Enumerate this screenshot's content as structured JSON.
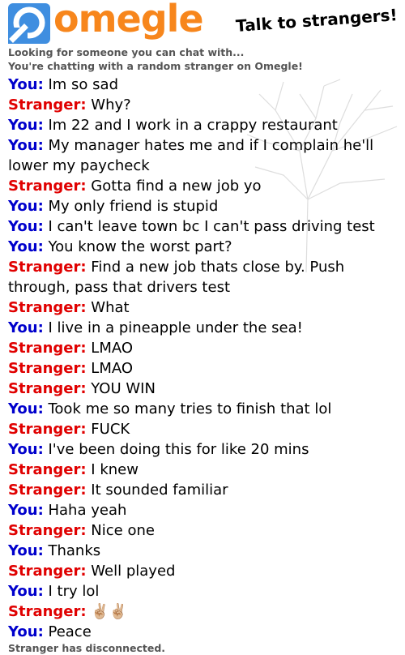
{
  "brand": {
    "logo_text": "omegle",
    "tagline": "Talk to strangers!",
    "colors": {
      "orange": "#f7861c",
      "blue": "#3f8ee0",
      "you": "#0000cc",
      "stranger": "#e00000"
    }
  },
  "status": {
    "looking": "Looking for someone you can chat with...",
    "chatting": "You're chatting with a random stranger on Omegle!",
    "disconnected": "Stranger has disconnected."
  },
  "messages": [
    {
      "speaker": "You:",
      "text": "Im so sad"
    },
    {
      "speaker": "Stranger:",
      "text": "Why?"
    },
    {
      "speaker": "You:",
      "text": "Im 22 and I work in a crappy restaurant"
    },
    {
      "speaker": "You:",
      "text": "My manager hates me and if I complain he'll lower my paycheck"
    },
    {
      "speaker": "Stranger:",
      "text": "Gotta find a new job yo"
    },
    {
      "speaker": "You:",
      "text": "My only friend is stupid"
    },
    {
      "speaker": "You:",
      "text": "I can't leave town bc I can't pass driving test"
    },
    {
      "speaker": "You:",
      "text": "You know the worst part?"
    },
    {
      "speaker": "Stranger:",
      "text": "Find a new job thats close by. Push through, pass that drivers test"
    },
    {
      "speaker": "Stranger:",
      "text": "What"
    },
    {
      "speaker": "You:",
      "text": "I live in a pineapple under the sea!"
    },
    {
      "speaker": "Stranger:",
      "text": "LMAO"
    },
    {
      "speaker": "Stranger:",
      "text": "LMAO"
    },
    {
      "speaker": "Stranger:",
      "text": "YOU WIN"
    },
    {
      "speaker": "You:",
      "text": "Took me so many tries to finish that lol"
    },
    {
      "speaker": "Stranger:",
      "text": "FUCK"
    },
    {
      "speaker": "You:",
      "text": "I've been doing this for like 20 mins"
    },
    {
      "speaker": "Stranger:",
      "text": "I knew"
    },
    {
      "speaker": "Stranger:",
      "text": "It sounded familiar"
    },
    {
      "speaker": "You:",
      "text": "Haha yeah"
    },
    {
      "speaker": "Stranger:",
      "text": "Nice one"
    },
    {
      "speaker": "You:",
      "text": "Thanks"
    },
    {
      "speaker": "Stranger:",
      "text": "Well played"
    },
    {
      "speaker": "You:",
      "text": "I try lol"
    },
    {
      "speaker": "Stranger:",
      "text": "✌🏼✌🏼"
    },
    {
      "speaker": "You:",
      "text": "Peace"
    }
  ]
}
